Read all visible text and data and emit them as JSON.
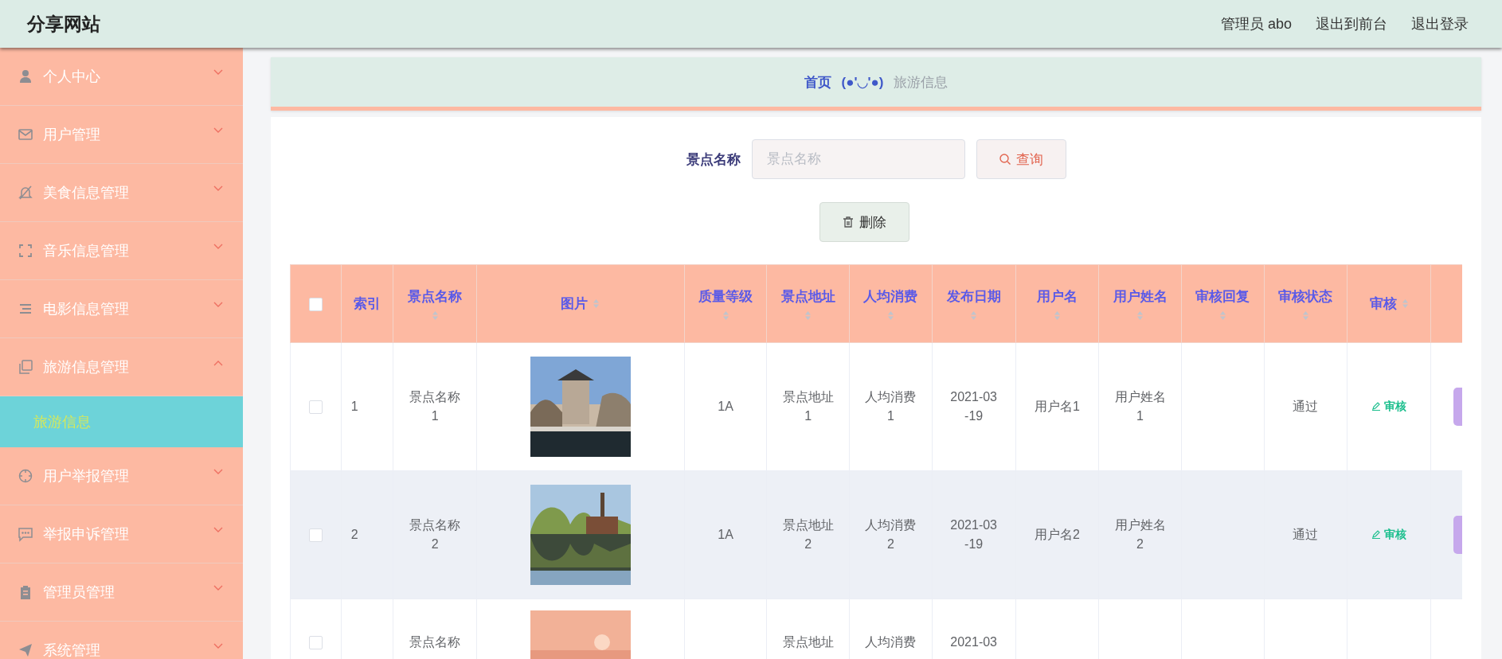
{
  "header": {
    "title": "分享网站",
    "links": [
      "管理员 abo",
      "退出到前台",
      "退出登录"
    ]
  },
  "sidebar": {
    "items": [
      {
        "label": "个人中心",
        "expanded": false
      },
      {
        "label": "用户管理",
        "expanded": false
      },
      {
        "label": "美食信息管理",
        "expanded": false
      },
      {
        "label": "音乐信息管理",
        "expanded": false
      },
      {
        "label": "电影信息管理",
        "expanded": false
      },
      {
        "label": "旅游信息管理",
        "expanded": true,
        "children": [
          {
            "label": "旅游信息",
            "selected": true
          }
        ]
      },
      {
        "label": "用户举报管理",
        "expanded": false
      },
      {
        "label": "举报申诉管理",
        "expanded": false
      },
      {
        "label": "管理员管理",
        "expanded": false
      },
      {
        "label": "系统管理",
        "expanded": false
      }
    ]
  },
  "breadcrumb": [
    "首页",
    "(●'◡'●)",
    "旅游信息"
  ],
  "search": {
    "label": "景点名称",
    "placeholder": "景点名称",
    "button": "查询"
  },
  "delete_button": "删除",
  "table": {
    "select_all": {
      "checked": false
    },
    "columns": [
      {
        "label": "索引",
        "sortable": false
      },
      {
        "label": "景点名称",
        "sortable": true
      },
      {
        "label": "图片",
        "sortable": true
      },
      {
        "label": "质量等级",
        "sortable": true
      },
      {
        "label": "景点地址",
        "sortable": true
      },
      {
        "label": "人均消费",
        "sortable": true
      },
      {
        "label": "发布日期",
        "sortable": true
      },
      {
        "label": "用户名",
        "sortable": true
      },
      {
        "label": "用户姓名",
        "sortable": true
      },
      {
        "label": "审核回复",
        "sortable": true
      },
      {
        "label": "审核状态",
        "sortable": true
      },
      {
        "label": "审核",
        "sortable": true
      }
    ],
    "rows": [
      {
        "checked": false,
        "hovered": false,
        "index": "1",
        "name": "景点名称1",
        "grade": "1A",
        "address": "景点地址1",
        "cost": "人均消费1",
        "date": "2021-03-19",
        "username": "用户名1",
        "fullname": "用户姓名1",
        "status": "通过",
        "action": "审核"
      },
      {
        "checked": false,
        "hovered": true,
        "index": "2",
        "name": "景点名称2",
        "grade": "1A",
        "address": "景点地址2",
        "cost": "人均消费2",
        "date": "2021-03-19",
        "username": "用户名2",
        "fullname": "用户姓名2",
        "status": "通过",
        "action": "审核"
      },
      {
        "checked": false,
        "hovered": false,
        "name": "景点名称",
        "address": "景点地址",
        "cost": "人均消费",
        "date": "2021-03"
      }
    ]
  }
}
